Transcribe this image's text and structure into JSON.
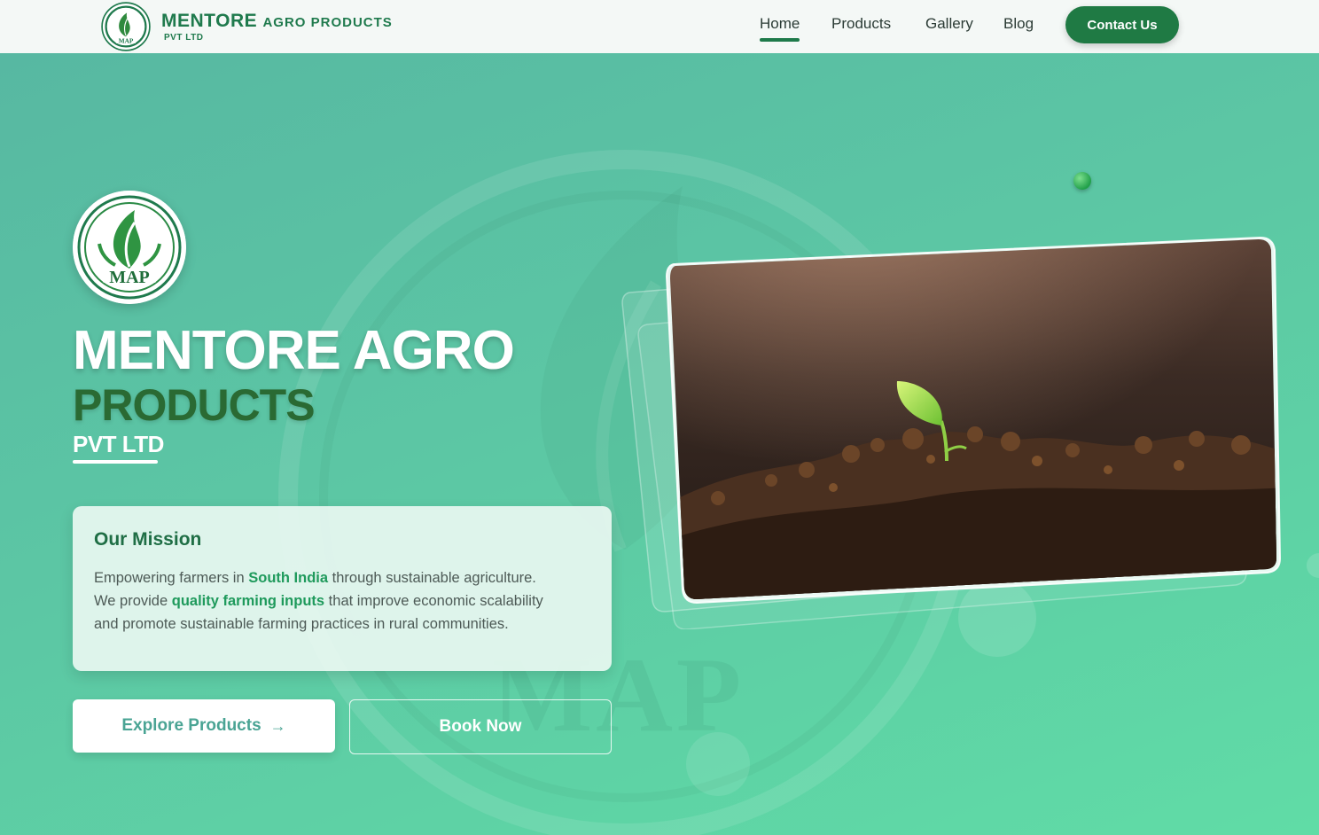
{
  "brand": {
    "name_main": "MENTORE",
    "name_rest": "AGRO PRODUCTS",
    "sub": "PVT LTD",
    "logo_text": "MAP"
  },
  "nav": {
    "links": [
      {
        "label": "Home",
        "active": true
      },
      {
        "label": "Products",
        "active": false
      },
      {
        "label": "Gallery",
        "active": false
      },
      {
        "label": "Blog",
        "active": false
      }
    ],
    "contact_label": "Contact Us"
  },
  "hero": {
    "title_line1": "MENTORE AGRO",
    "title_line2": "PRODUCTS",
    "title_line3": "PVT LTD",
    "watermark_text": "MAP",
    "mission": {
      "title": "Our Mission",
      "p1_a": "Empowering farmers in ",
      "p1_hl": "South India",
      "p1_b": " through sustainable agriculture.",
      "p2_a": "We provide ",
      "p2_hl": "quality farming inputs",
      "p2_b": " that improve economic scalability",
      "p3": "and promote sustainable farming practices in rural communities."
    },
    "explore_label": "Explore Products",
    "explore_icon": "arrow-right-icon",
    "book_label": "Book Now"
  },
  "colors": {
    "brand_green": "#1f7a4d",
    "contact_bg": "#1f7a44",
    "title_dark": "#2a6a33",
    "highlight": "#1f9a5c"
  }
}
